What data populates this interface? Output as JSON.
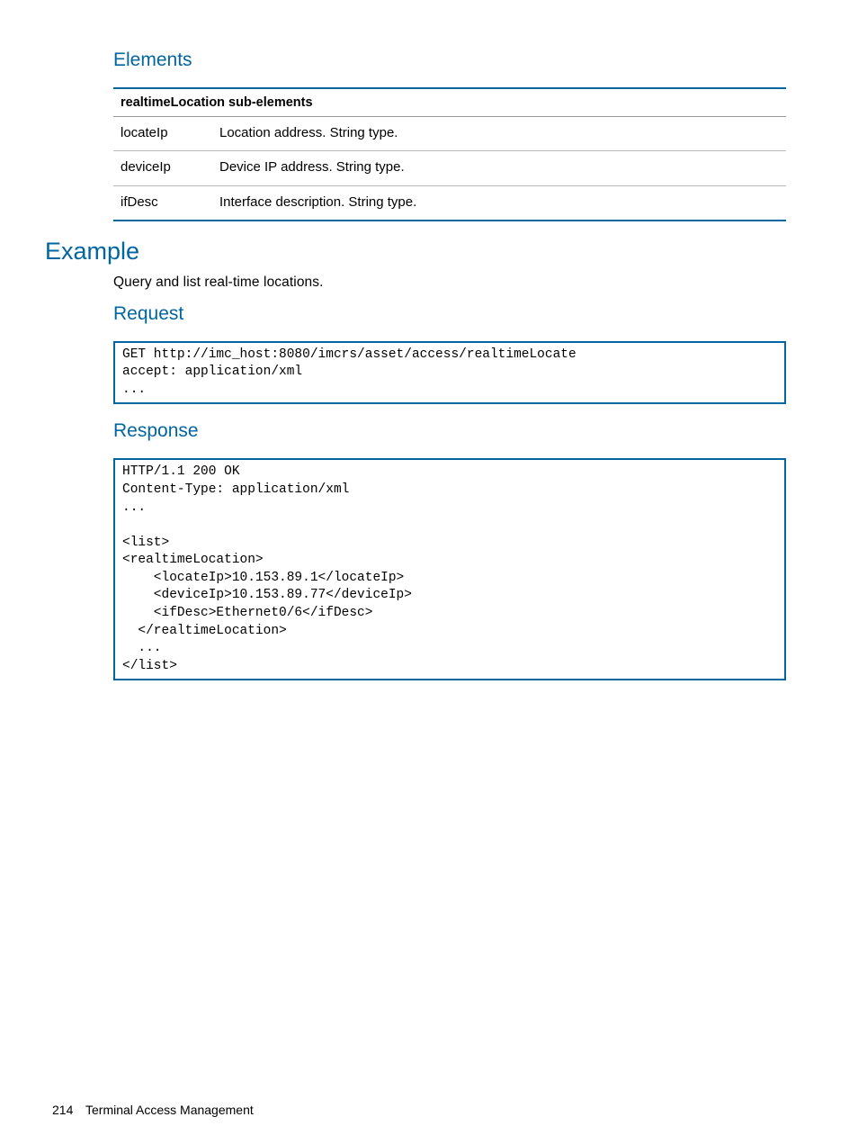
{
  "headings": {
    "elements": "Elements",
    "example": "Example",
    "request": "Request",
    "response": "Response"
  },
  "table": {
    "header": "realtimeLocation sub-elements",
    "rows": [
      {
        "name": "locateIp",
        "desc": "Location address.\nString type."
      },
      {
        "name": "deviceIp",
        "desc": "Device IP address.\nString type."
      },
      {
        "name": "ifDesc",
        "desc": "Interface description.\nString type."
      }
    ]
  },
  "example_desc": "Query and list real-time locations.",
  "request_code": "GET http://imc_host:8080/imcrs/asset/access/realtimeLocate\naccept: application/xml\n...",
  "response_code": "HTTP/1.1 200 OK\nContent-Type: application/xml\n...\n\n<list>\n<realtimeLocation>\n    <locateIp>10.153.89.1</locateIp>\n    <deviceIp>10.153.89.77</deviceIp>\n    <ifDesc>Ethernet0/6</ifDesc>\n  </realtimeLocation>\n  ...\n</list>",
  "footer": {
    "page": "214",
    "section": "Terminal Access Management"
  }
}
